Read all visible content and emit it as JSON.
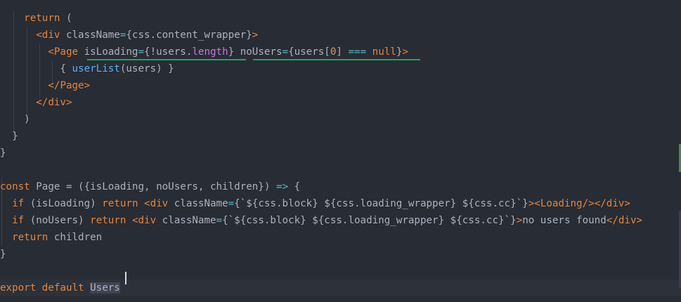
{
  "editor": {
    "lines": [
      [
        {
          "t": "    "
        },
        {
          "t": "return",
          "c": "kw"
        },
        {
          "t": " ("
        }
      ],
      [
        {
          "t": "      "
        },
        {
          "t": "<",
          "c": "tag"
        },
        {
          "t": "div",
          "c": "tag"
        },
        {
          "t": " className",
          "c": "attr"
        },
        {
          "t": "=",
          "c": "op"
        },
        {
          "t": "{css.content_wrapper}"
        },
        {
          "t": ">",
          "c": "tag"
        }
      ],
      [
        {
          "t": "        "
        },
        {
          "t": "<",
          "c": "tag"
        },
        {
          "t": "Page",
          "c": "tag"
        },
        {
          "t": " isLoading",
          "c": "attr"
        },
        {
          "t": "=",
          "c": "op"
        },
        {
          "t": "{!users."
        },
        {
          "t": "length",
          "c": "lit"
        },
        {
          "t": "}"
        },
        {
          "t": " noUsers",
          "c": "attr"
        },
        {
          "t": "=",
          "c": "op"
        },
        {
          "t": "{users["
        },
        {
          "t": "0",
          "c": "num"
        },
        {
          "t": "] "
        },
        {
          "t": "===",
          "c": "op"
        },
        {
          "t": " "
        },
        {
          "t": "null",
          "c": "kw"
        },
        {
          "t": "}"
        },
        {
          "t": ">",
          "c": "tag"
        }
      ],
      [
        {
          "t": "          { "
        },
        {
          "t": "userList",
          "c": "fn"
        },
        {
          "t": "(users) }"
        }
      ],
      [
        {
          "t": "        "
        },
        {
          "t": "</",
          "c": "tag"
        },
        {
          "t": "Page",
          "c": "tag"
        },
        {
          "t": ">",
          "c": "tag"
        }
      ],
      [
        {
          "t": "      "
        },
        {
          "t": "</",
          "c": "tag"
        },
        {
          "t": "div",
          "c": "tag"
        },
        {
          "t": ">",
          "c": "tag"
        }
      ],
      [
        {
          "t": "    )"
        }
      ],
      [
        {
          "t": "  }"
        }
      ],
      [
        {
          "t": "}"
        }
      ],
      [],
      [
        {
          "t": "const",
          "c": "kw"
        },
        {
          "t": " Page = ({isLoading, noUsers, children}) "
        },
        {
          "t": "=>",
          "c": "op"
        },
        {
          "t": " {"
        }
      ],
      [
        {
          "t": "  "
        },
        {
          "t": "if",
          "c": "kw"
        },
        {
          "t": " (isLoading) "
        },
        {
          "t": "return",
          "c": "kw"
        },
        {
          "t": " "
        },
        {
          "t": "<",
          "c": "tag"
        },
        {
          "t": "div",
          "c": "tag"
        },
        {
          "t": " className",
          "c": "attr"
        },
        {
          "t": "=",
          "c": "op"
        },
        {
          "t": "{`${css.block} ${css.loading_wrapper} ${css.cc}`}"
        },
        {
          "t": ">",
          "c": "tag"
        },
        {
          "t": "<",
          "c": "tag"
        },
        {
          "t": "Loading",
          "c": "tag"
        },
        {
          "t": "/>",
          "c": "tag"
        },
        {
          "t": "</",
          "c": "tag"
        },
        {
          "t": "div",
          "c": "tag"
        },
        {
          "t": ">",
          "c": "tag"
        }
      ],
      [
        {
          "t": "  "
        },
        {
          "t": "if",
          "c": "kw"
        },
        {
          "t": " (noUsers) "
        },
        {
          "t": "return",
          "c": "kw"
        },
        {
          "t": " "
        },
        {
          "t": "<",
          "c": "tag"
        },
        {
          "t": "div",
          "c": "tag"
        },
        {
          "t": " className",
          "c": "attr"
        },
        {
          "t": "=",
          "c": "op"
        },
        {
          "t": "{`${css.block} ${css.loading_wrapper} ${css.cc}`}"
        },
        {
          "t": ">",
          "c": "tag"
        },
        {
          "t": "no users found"
        },
        {
          "t": "</",
          "c": "tag"
        },
        {
          "t": "div",
          "c": "tag"
        },
        {
          "t": ">",
          "c": "tag"
        }
      ],
      [
        {
          "t": "  "
        },
        {
          "t": "return",
          "c": "kw"
        },
        {
          "t": " children"
        }
      ],
      [
        {
          "t": "}"
        }
      ],
      [],
      [
        {
          "t": "export",
          "c": "kw"
        },
        {
          "t": " "
        },
        {
          "t": "default",
          "c": "kw"
        },
        {
          "t": " "
        },
        {
          "t": "Users",
          "hl": true
        }
      ]
    ]
  },
  "colors": {
    "background": "#282c34",
    "keyword": "#e5853f",
    "function": "#61afef",
    "number": "#d19a66",
    "property": "#c678dd",
    "operator": "#56b6c2",
    "squiggle": "#1fa55a"
  }
}
